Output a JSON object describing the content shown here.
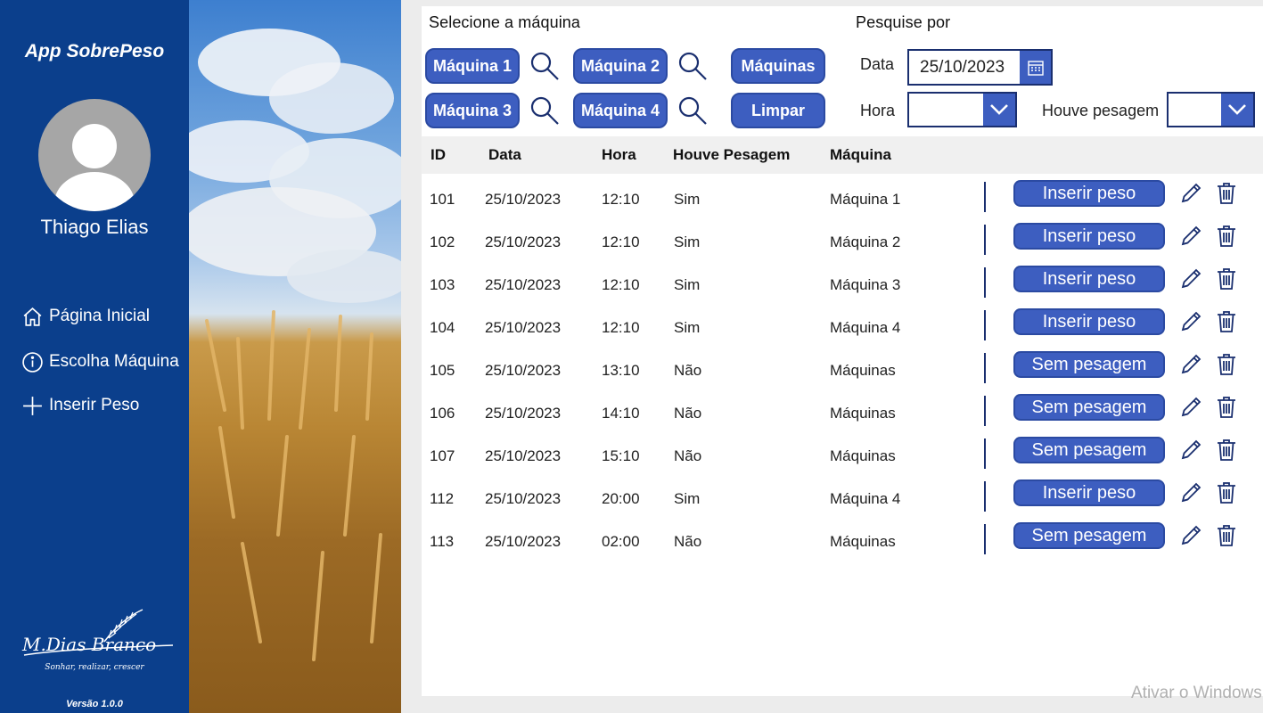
{
  "sidebar": {
    "app_title": "App SobrePeso",
    "user_name": "Thiago Elias",
    "nav": [
      {
        "label": "Página Inicial",
        "icon": "home-icon"
      },
      {
        "label": "Escolha Máquina",
        "icon": "info-icon"
      },
      {
        "label": "Inserir Peso",
        "icon": "plus-icon"
      }
    ],
    "logo_tagline": "Sonhar, realizar, crescer",
    "version": "Versão 1.0.0"
  },
  "filters": {
    "select_machine_label": "Selecione a máquina",
    "search_by_label": "Pesquise por",
    "machine_buttons": [
      "Máquina 1",
      "Máquina 2",
      "Máquinas",
      "Máquina 3",
      "Máquina 4",
      "Limpar"
    ],
    "date_label": "Data",
    "date_value": "25/10/2023",
    "hour_label": "Hora",
    "hour_value": "",
    "weighing_label": "Houve pesagem",
    "weighing_value": ""
  },
  "table": {
    "columns": [
      "ID",
      "Data",
      "Hora",
      "Houve Pesagem",
      "Máquina"
    ],
    "rows": [
      {
        "id": "101",
        "date": "25/10/2023",
        "hour": "12:10",
        "weighed": "Sim",
        "machine": "Máquina 1",
        "action": "Inserir peso"
      },
      {
        "id": "102",
        "date": "25/10/2023",
        "hour": "12:10",
        "weighed": "Sim",
        "machine": "Máquina 2",
        "action": "Inserir peso"
      },
      {
        "id": "103",
        "date": "25/10/2023",
        "hour": "12:10",
        "weighed": "Sim",
        "machine": "Máquina 3",
        "action": "Inserir peso"
      },
      {
        "id": "104",
        "date": "25/10/2023",
        "hour": "12:10",
        "weighed": "Sim",
        "machine": "Máquina 4",
        "action": "Inserir peso"
      },
      {
        "id": "105",
        "date": "25/10/2023",
        "hour": "13:10",
        "weighed": "Não",
        "machine": "Máquinas",
        "action": "Sem pesagem"
      },
      {
        "id": "106",
        "date": "25/10/2023",
        "hour": "14:10",
        "weighed": "Não",
        "machine": "Máquinas",
        "action": "Sem pesagem"
      },
      {
        "id": "107",
        "date": "25/10/2023",
        "hour": "15:10",
        "weighed": "Não",
        "machine": "Máquinas",
        "action": "Sem pesagem"
      },
      {
        "id": "112",
        "date": "25/10/2023",
        "hour": "20:00",
        "weighed": "Sim",
        "machine": "Máquina 4",
        "action": "Inserir peso"
      },
      {
        "id": "113",
        "date": "25/10/2023",
        "hour": "02:00",
        "weighed": "Não",
        "machine": "Máquinas",
        "action": "Sem pesagem"
      }
    ]
  },
  "os_watermark": "Ativar o Windows",
  "colors": {
    "sidebar": "#0b3f8c",
    "button": "#3d5ec0",
    "border": "#1a2f6f"
  }
}
